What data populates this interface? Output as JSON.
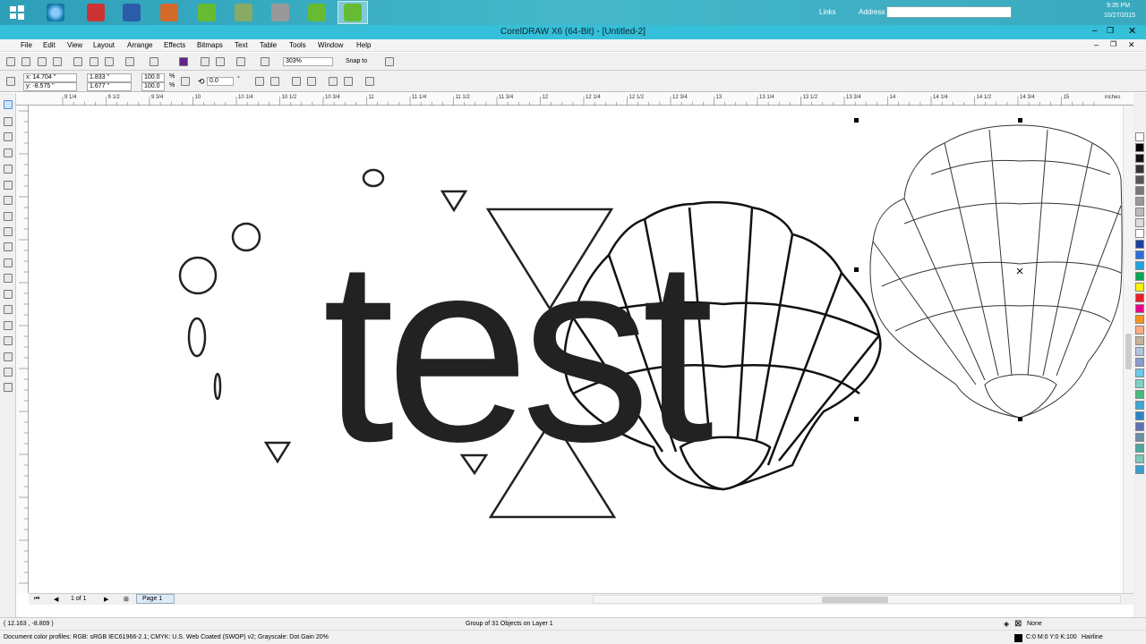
{
  "taskbar": {
    "links_label": "Links",
    "address_label": "Address",
    "time": "9:35 PM",
    "date": "10/27/2015"
  },
  "window": {
    "title": "CorelDRAW X6 (64-Bit) - [Untitled-2]"
  },
  "menu": [
    "File",
    "Edit",
    "View",
    "Layout",
    "Arrange",
    "Effects",
    "Bitmaps",
    "Text",
    "Table",
    "Tools",
    "Window",
    "Help"
  ],
  "toolbar": {
    "zoom": "303%",
    "snap_to": "Snap to"
  },
  "property_bar": {
    "x": "x: 14.704 \"",
    "y": "y: -8.575 \"",
    "width": "1.833 \"",
    "height": "1.677 \"",
    "scale_w": "100.0",
    "scale_h": "100.0",
    "percent": "%",
    "angle": "0.0",
    "degree": "°"
  },
  "ruler": {
    "units": "inches",
    "ticks": [
      "9 1/4",
      "9 1/2",
      "9 3/4",
      "10",
      "10 1/4",
      "10 1/2",
      "10 3/4",
      "11",
      "11 1/4",
      "11 1/2",
      "11 3/4",
      "12",
      "12 1/4",
      "12 1/2",
      "12 3/4",
      "13",
      "13 1/4",
      "13 1/2",
      "13 3/4",
      "14",
      "14 1/4",
      "14 1/2",
      "14 3/4",
      "15"
    ]
  },
  "canvas": {
    "text": "test"
  },
  "page_nav": {
    "count": "1 of 1",
    "tab": "Page 1"
  },
  "status": {
    "coords": "( 12.163 , -8.809 )",
    "selection": "Group of 31 Objects on Layer 1",
    "fill": "None",
    "profiles": "Document color profiles: RGB: sRGB IEC61966-2.1; CMYK: U.S. Web Coated (SWOP) v2; Grayscale: Dot Gain 20%",
    "outline_color": "C:0 M:0 Y:0 K:100",
    "outline_width": "Hairline"
  },
  "palette_colors": [
    "#ffffff",
    "#000000",
    "#111111",
    "#333333",
    "#555555",
    "#777777",
    "#999999",
    "#bbbbbb",
    "#dddddd",
    "#ffffff",
    "#1b3fa0",
    "#2a6fd8",
    "#1fa2e0",
    "#00a651",
    "#fff200",
    "#ed1c24",
    "#ec008c",
    "#f7941d",
    "#f9ad81",
    "#c7b299",
    "#b0c4de",
    "#8a9ad0",
    "#6ec6e8",
    "#7fd1c7",
    "#48b97e",
    "#3fa7d6",
    "#2b83c6",
    "#5f6fb3",
    "#6b8fa3",
    "#4fa8a0",
    "#7ec8b7",
    "#3c9bcf"
  ]
}
